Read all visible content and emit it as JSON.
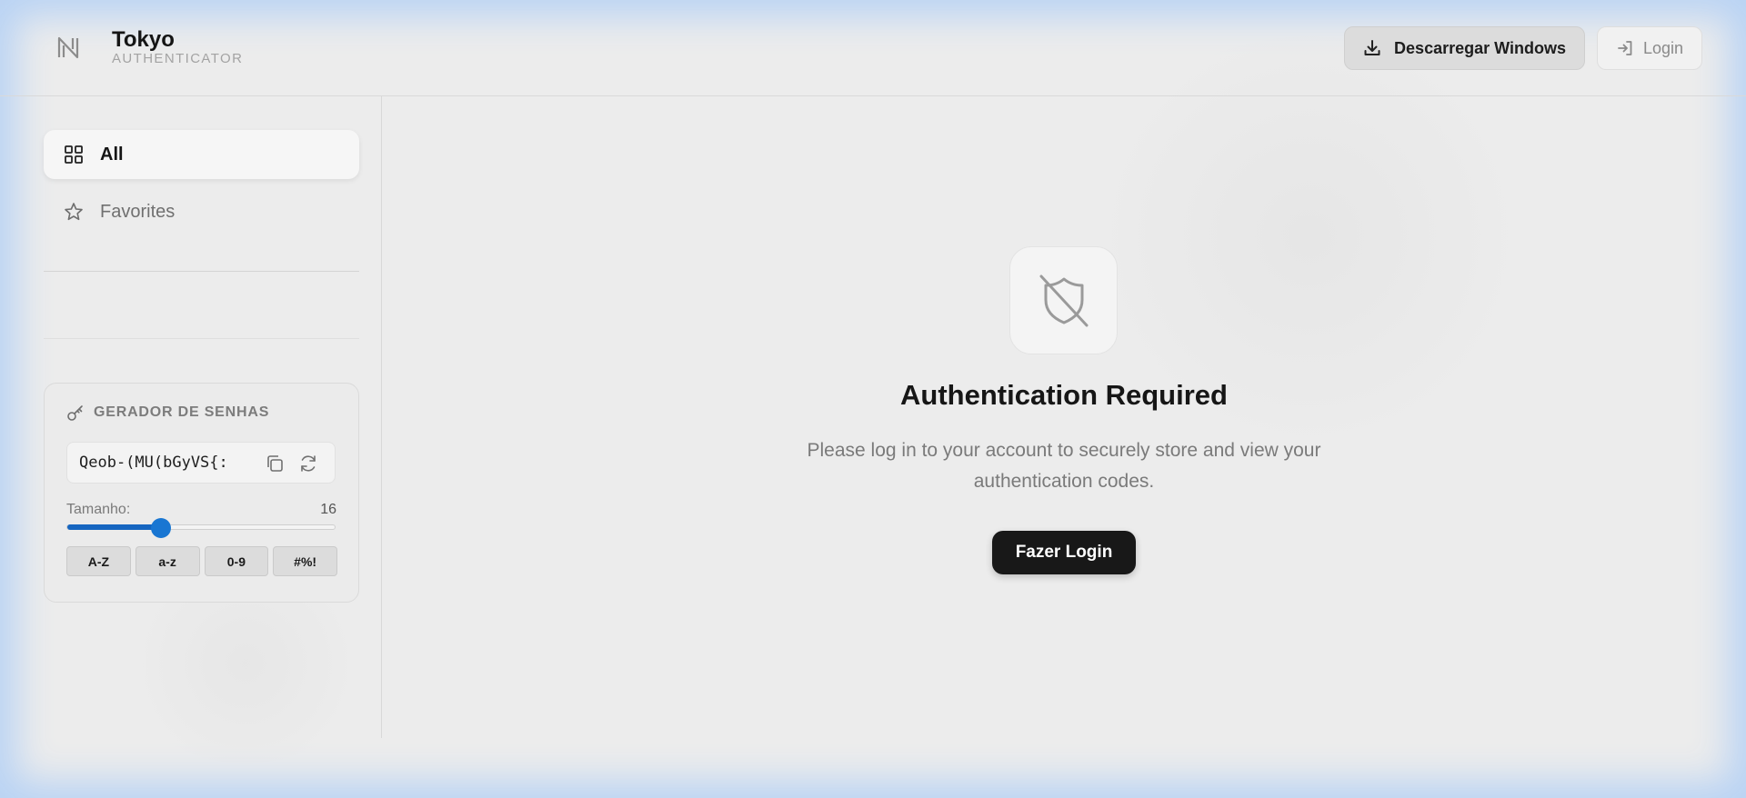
{
  "colors": {
    "accent": "#1976d2",
    "primary_button": "#181818",
    "background": "#ececec",
    "window_glow": "#b9d3f4"
  },
  "header": {
    "logo_icon": "n-logo-icon",
    "title": "Tokyo",
    "subtitle": "AUTHENTICATOR",
    "download_button": {
      "label": "Descarregar Windows",
      "icon": "download-icon"
    },
    "login_button": {
      "label": "Login",
      "icon": "login-icon"
    }
  },
  "sidebar": {
    "nav": [
      {
        "label": "All",
        "icon": "grid-icon",
        "active": true
      },
      {
        "label": "Favorites",
        "icon": "star-icon",
        "active": false
      }
    ],
    "generator": {
      "icon": "key-icon",
      "title": "GERADOR DE SENHAS",
      "password": "Qeob-(MU(bGyVS{:",
      "copy_icon": "copy-icon",
      "refresh_icon": "refresh-icon",
      "length_label": "Tamanho:",
      "length_value": "16",
      "length_fraction": 0.35,
      "options": [
        "A-Z",
        "a-z",
        "0-9",
        "#%!"
      ]
    }
  },
  "main": {
    "icon": "shield-off-icon",
    "title": "Authentication Required",
    "description": "Please log in to your account to securely store and view your authentication codes.",
    "login_button": "Fazer Login"
  }
}
